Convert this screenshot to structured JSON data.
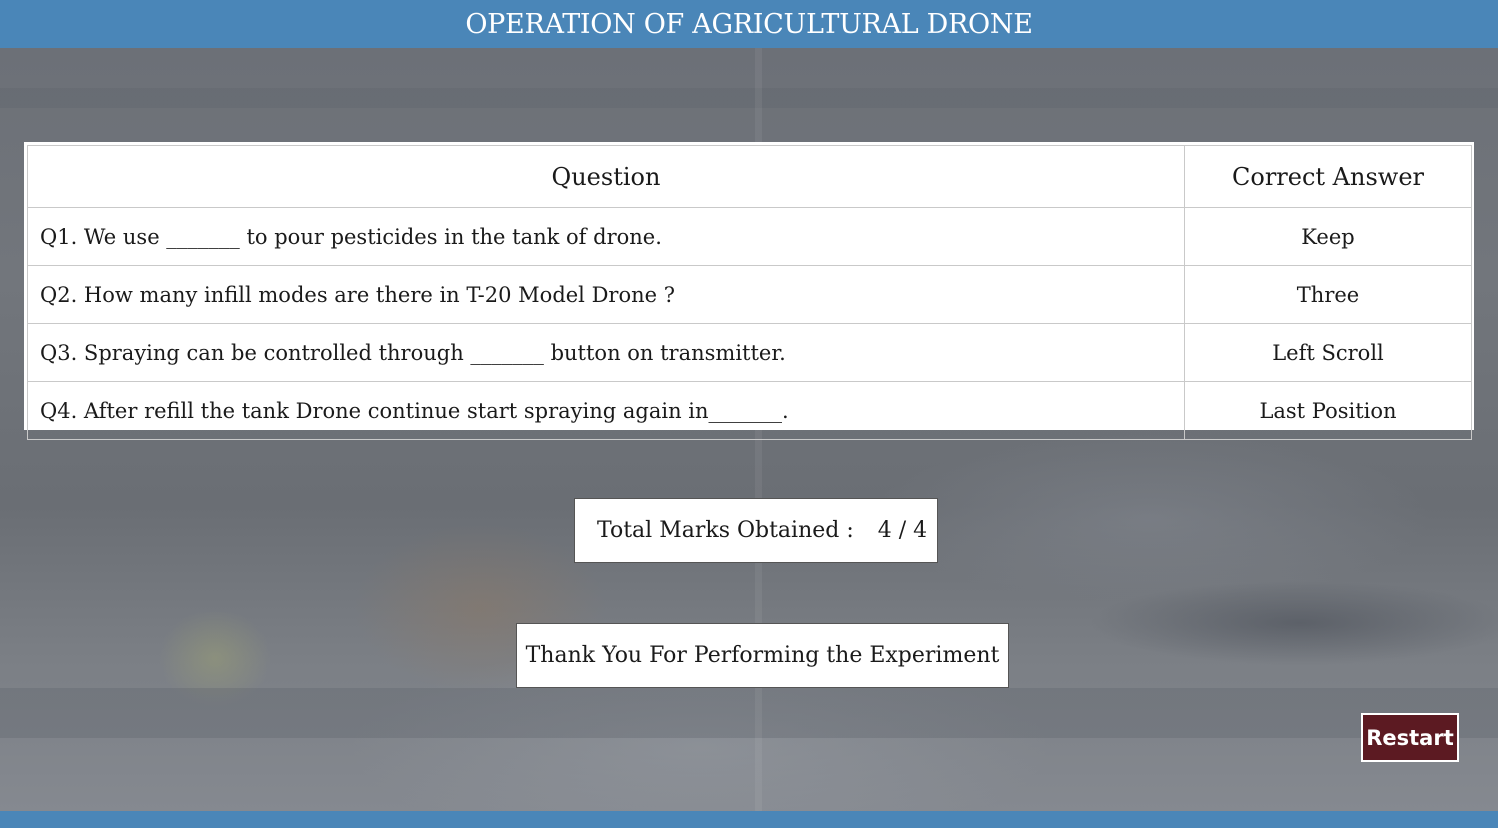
{
  "header": {
    "title": "OPERATION OF AGRICULTURAL DRONE"
  },
  "results_table": {
    "columns": [
      "Question",
      "Correct Answer"
    ],
    "rows": [
      {
        "question": "Q1. We use _______ to pour pesticides in the tank of drone.",
        "answer": "Keep"
      },
      {
        "question": "Q2. How many infill modes are there in T-20 Model Drone ?",
        "answer": "Three"
      },
      {
        "question": "Q3. Spraying can be controlled through _______ button on transmitter.",
        "answer": "Left Scroll"
      },
      {
        "question": "Q4. After refill the tank Drone continue start spraying again in_______.",
        "answer": "Last Position"
      }
    ]
  },
  "marks": {
    "label": "Total Marks Obtained :",
    "score": "4 / 4"
  },
  "thanks_message": "Thank You For Performing the Experiment",
  "restart_label": "Restart",
  "colors": {
    "header_bar": "#4a86b8",
    "restart_button": "#5c1a22"
  }
}
